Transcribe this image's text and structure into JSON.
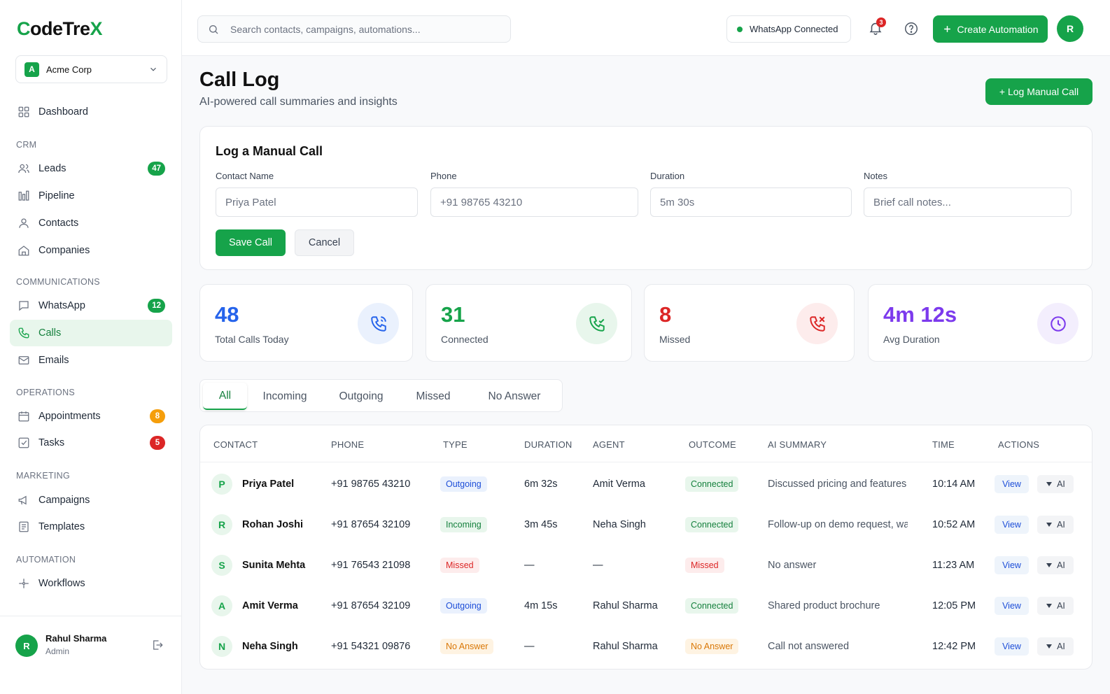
{
  "app": {
    "logo_text_1": "C",
    "logo_text_2": "odeTre",
    "logo_text_3": "X"
  },
  "workspace": {
    "initial": "A",
    "name": "Acme Corp"
  },
  "sidebar": {
    "dashboard": "Dashboard",
    "sections": {
      "crm": "CRM",
      "communications": "COMMUNICATIONS",
      "operations": "OPERATIONS",
      "marketing": "MARKETING",
      "automation": "AUTOMATION"
    },
    "items": {
      "leads": {
        "label": "Leads",
        "count": "47"
      },
      "pipeline": {
        "label": "Pipeline"
      },
      "contacts": {
        "label": "Contacts"
      },
      "companies": {
        "label": "Companies"
      },
      "whatsapp": {
        "label": "WhatsApp",
        "count": "12"
      },
      "calls": {
        "label": "Calls"
      },
      "emails": {
        "label": "Emails"
      },
      "appointments": {
        "label": "Appointments",
        "count": "8"
      },
      "tasks": {
        "label": "Tasks",
        "count": "5"
      },
      "campaigns": {
        "label": "Campaigns"
      },
      "templates": {
        "label": "Templates"
      },
      "workflows": {
        "label": "Workflows"
      }
    },
    "user": {
      "initial": "R",
      "name": "Rahul Sharma",
      "role": "Admin"
    }
  },
  "topbar": {
    "search_placeholder": "Search contacts, campaigns, automations...",
    "whatsapp_status": "WhatsApp Connected",
    "notification_count": "3",
    "create_label": "Create Automation",
    "avatar_initial": "R"
  },
  "page": {
    "title": "Call Log",
    "subtitle": "AI-powered call summaries and insights",
    "log_button": "+ Log Manual Call"
  },
  "form": {
    "title": "Log a Manual Call",
    "contact_label": "Contact Name",
    "contact_placeholder": "Priya Patel",
    "phone_label": "Phone",
    "phone_placeholder": "+91 98765 43210",
    "duration_label": "Duration",
    "duration_placeholder": "5m 30s",
    "notes_label": "Notes",
    "notes_placeholder": "Brief call notes...",
    "save_label": "Save Call",
    "cancel_label": "Cancel"
  },
  "stats": [
    {
      "value": "48",
      "label": "Total Calls Today",
      "color": "#2563eb",
      "icon_bg": "#eaf1fd",
      "icon": "phone-call-icon"
    },
    {
      "value": "31",
      "label": "Connected",
      "color": "#16a34a",
      "icon_bg": "#e8f6ec",
      "icon": "phone-connected-icon"
    },
    {
      "value": "8",
      "label": "Missed",
      "color": "#dc2626",
      "icon_bg": "#fdecec",
      "icon": "phone-missed-icon"
    },
    {
      "value": "4m 12s",
      "label": "Avg Duration",
      "color": "#7c3aed",
      "icon_bg": "#f3eefd",
      "icon": "clock-icon"
    }
  ],
  "tabs": [
    "All",
    "Incoming",
    "Outgoing",
    "Missed",
    "No Answer"
  ],
  "table": {
    "headers": [
      "CONTACT",
      "PHONE",
      "TYPE",
      "DURATION",
      "AGENT",
      "OUTCOME",
      "AI SUMMARY",
      "TIME",
      "ACTIONS"
    ],
    "view_label": "View",
    "ai_label": "AI",
    "rows": [
      {
        "initial": "P",
        "name": "Priya Patel",
        "phone": "+91 98765 43210",
        "type": "Outgoing",
        "duration": "6m 32s",
        "agent": "Amit Verma",
        "outcome": "Connected",
        "summary": "Discussed pricing and features",
        "time": "10:14 AM"
      },
      {
        "initial": "R",
        "name": "Rohan Joshi",
        "phone": "+91 87654 32109",
        "type": "Incoming",
        "duration": "3m 45s",
        "agent": "Neha Singh",
        "outcome": "Connected",
        "summary": "Follow-up on demo request, wa",
        "time": "10:52 AM"
      },
      {
        "initial": "S",
        "name": "Sunita Mehta",
        "phone": "+91 76543 21098",
        "type": "Missed",
        "duration": "—",
        "agent": "—",
        "outcome": "Missed",
        "summary": "No answer",
        "time": "11:23 AM"
      },
      {
        "initial": "A",
        "name": "Amit Verma",
        "phone": "+91 87654 32109",
        "type": "Outgoing",
        "duration": "4m 15s",
        "agent": "Rahul Sharma",
        "outcome": "Connected",
        "summary": "Shared product brochure",
        "time": "12:05 PM"
      },
      {
        "initial": "N",
        "name": "Neha Singh",
        "phone": "+91 54321 09876",
        "type": "No Answer",
        "duration": "—",
        "agent": "Rahul Sharma",
        "outcome": "No Answer",
        "summary": "Call not answered",
        "time": "12:42 PM"
      }
    ]
  },
  "colors": {
    "brand": "#16a34a",
    "type_outgoing": {
      "bg": "#eaf1fd",
      "fg": "#1d4ed8"
    },
    "type_incoming": {
      "bg": "#e8f6ec",
      "fg": "#15803d"
    },
    "type_missed": {
      "bg": "#fdecec",
      "fg": "#dc2626"
    },
    "type_no_answer": {
      "bg": "#fef3e2",
      "fg": "#d97706"
    }
  }
}
